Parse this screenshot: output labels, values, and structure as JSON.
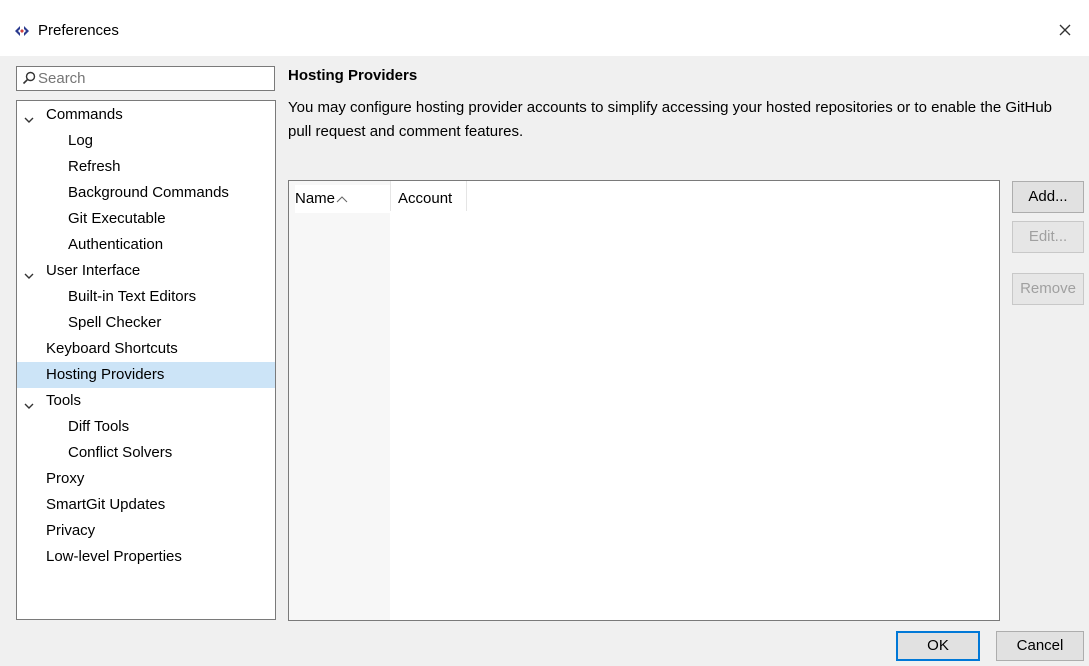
{
  "window": {
    "title": "Preferences",
    "app_icon": "smartgit-icon",
    "close_icon": "close-icon"
  },
  "search": {
    "placeholder": "Search",
    "value": ""
  },
  "tree": {
    "items": [
      {
        "label": "Commands",
        "level": 0,
        "expanded": true
      },
      {
        "label": "Log",
        "level": 1
      },
      {
        "label": "Refresh",
        "level": 1
      },
      {
        "label": "Background Commands",
        "level": 1
      },
      {
        "label": "Git Executable",
        "level": 1
      },
      {
        "label": "Authentication",
        "level": 1
      },
      {
        "label": "User Interface",
        "level": 0,
        "expanded": true
      },
      {
        "label": "Built-in Text Editors",
        "level": 1
      },
      {
        "label": "Spell Checker",
        "level": 1
      },
      {
        "label": "Keyboard Shortcuts",
        "level": 0
      },
      {
        "label": "Hosting Providers",
        "level": 0,
        "selected": true
      },
      {
        "label": "Tools",
        "level": 0,
        "expanded": true
      },
      {
        "label": "Diff Tools",
        "level": 1
      },
      {
        "label": "Conflict Solvers",
        "level": 1
      },
      {
        "label": "Proxy",
        "level": 0
      },
      {
        "label": "SmartGit Updates",
        "level": 0
      },
      {
        "label": "Privacy",
        "level": 0
      },
      {
        "label": "Low-level Properties",
        "level": 0
      }
    ]
  },
  "page": {
    "heading": "Hosting Providers",
    "description": "You may configure hosting provider accounts to simplify accessing your hosted repositories or to enable the GitHub pull request and comment features."
  },
  "table": {
    "columns": [
      "Name",
      "Account"
    ],
    "sorted_column": "Name",
    "rows": []
  },
  "buttons": {
    "add": "Add...",
    "edit": "Edit...",
    "remove": "Remove",
    "ok": "OK",
    "cancel": "Cancel"
  },
  "colors": {
    "selection": "#cce4f7",
    "default_button_border": "#0078d7",
    "app_icon": "#2b3b8f"
  }
}
